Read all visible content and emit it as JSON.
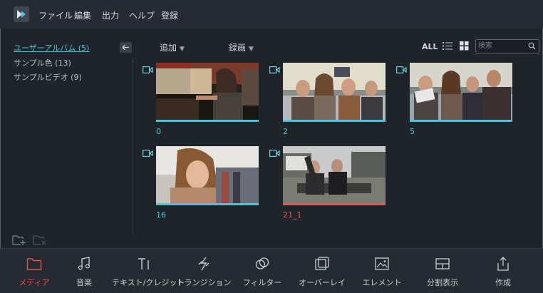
{
  "menu": {
    "items": [
      "ファイル",
      "編集",
      "出力",
      "ヘルプ",
      "登録"
    ]
  },
  "sidebar": {
    "albums": [
      {
        "label": "ユーザーアルバム (5)",
        "active": true
      },
      {
        "label": "サンプル色 (13)",
        "active": false
      },
      {
        "label": "サンプルビデオ (9)",
        "active": false
      }
    ]
  },
  "toolbar": {
    "add_label": "追加",
    "record_label": "録画",
    "all_label": "ALL",
    "search_placeholder": "検索"
  },
  "clips": [
    {
      "name": "0",
      "status_color": "#4fc3d4"
    },
    {
      "name": "2",
      "status_color": "#4fc3d4"
    },
    {
      "name": "5",
      "status_color": "#4fc3d4"
    },
    {
      "name": "16",
      "status_color": "#4fc3d4"
    },
    {
      "name": "21_1",
      "status_color": "#e05656"
    }
  ],
  "tabs": [
    {
      "label": "メディア",
      "icon": "folder-icon",
      "active": true
    },
    {
      "label": "音楽",
      "icon": "music-note-icon",
      "active": false
    },
    {
      "label": "テキスト/クレジット",
      "icon": "text-icon",
      "active": false
    },
    {
      "label": "トランジション",
      "icon": "transition-icon",
      "active": false
    },
    {
      "label": "フィルター",
      "icon": "filter-icon",
      "active": false
    },
    {
      "label": "オーバーレイ",
      "icon": "overlay-icon",
      "active": false
    },
    {
      "label": "エレメント",
      "icon": "image-icon",
      "active": false
    },
    {
      "label": "分割表示",
      "icon": "split-screen-icon",
      "active": false
    },
    {
      "label": "作成",
      "icon": "export-icon",
      "active": false
    }
  ],
  "colors": {
    "accent": "#4fc3d4",
    "active_tab": "#e2524f",
    "background": "#1f242b"
  }
}
